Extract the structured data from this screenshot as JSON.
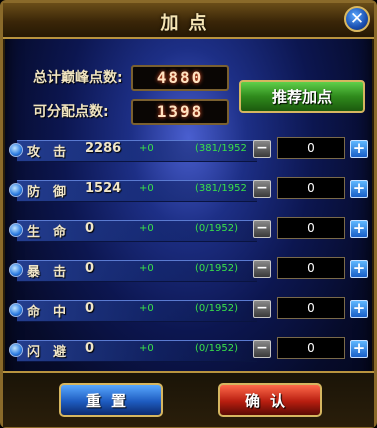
{
  "window": {
    "title": "加点"
  },
  "summary": {
    "total_label": "总计巅峰点数:",
    "total_value": "4880",
    "available_label": "可分配点数:",
    "available_value": "1398",
    "recommend_label": "推荐加点"
  },
  "stats": [
    {
      "name": "攻击",
      "value": "2286",
      "bonus": "+0",
      "ratio": "(381/1952",
      "input": "0"
    },
    {
      "name": "防御",
      "value": "1524",
      "bonus": "+0",
      "ratio": "(381/1952",
      "input": "0"
    },
    {
      "name": "生命",
      "value": "0",
      "bonus": "+0",
      "ratio": "(0/1952)",
      "input": "0"
    },
    {
      "name": "暴击",
      "value": "0",
      "bonus": "+0",
      "ratio": "(0/1952)",
      "input": "0"
    },
    {
      "name": "命中",
      "value": "0",
      "bonus": "+0",
      "ratio": "(0/1952)",
      "input": "0"
    },
    {
      "name": "闪避",
      "value": "0",
      "bonus": "+0",
      "ratio": "(0/1952)",
      "input": "0"
    }
  ],
  "controls": {
    "minus_symbol": "−",
    "plus_symbol": "+",
    "close_symbol": "✕"
  },
  "buttons": {
    "reset": "重置",
    "confirm": "确认"
  }
}
